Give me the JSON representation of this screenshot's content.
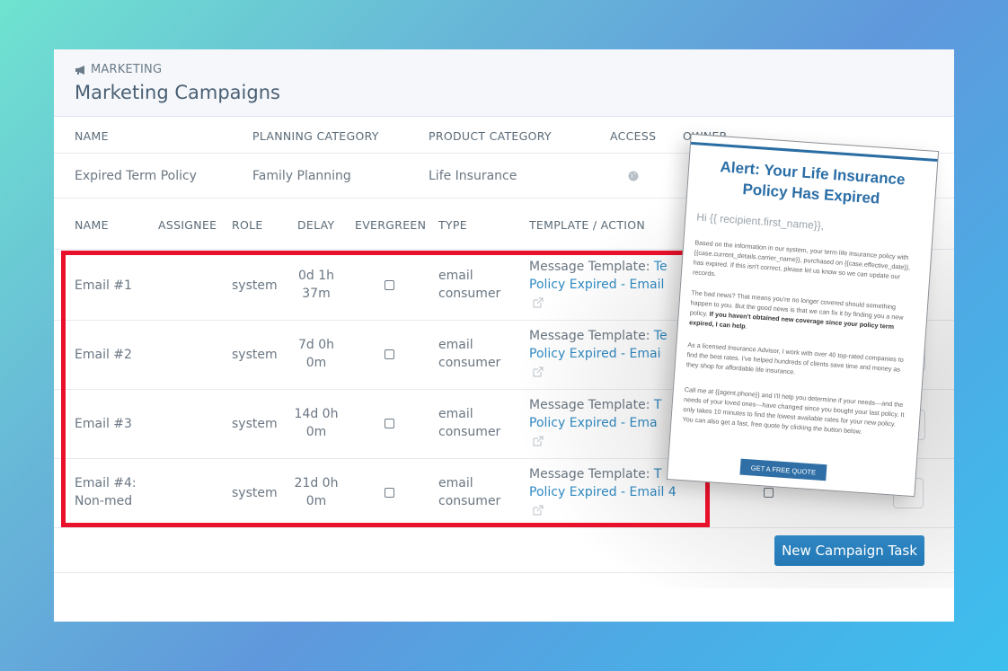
{
  "breadcrumb": {
    "icon": "megaphone-icon",
    "label": "MARKETING"
  },
  "page_title": "Marketing Campaigns",
  "campaign_table": {
    "headers": [
      "NAME",
      "PLANNING CATEGORY",
      "PRODUCT CATEGORY",
      "ACCESS",
      "OWNER"
    ],
    "row": {
      "name": "Expired Term Policy",
      "planning_category": "Family Planning",
      "product_category": "Life Insurance",
      "access_icon": "globe-icon"
    }
  },
  "tasks_table": {
    "headers": [
      "NAME",
      "ASSIGNEE",
      "ROLE",
      "DELAY",
      "EVERGREEN",
      "TYPE",
      "TEMPLATE / ACTION"
    ],
    "rows": [
      {
        "name": "Email #1",
        "assignee": "",
        "role": "system",
        "delay_line1": "0d 1h",
        "delay_line2": "37m",
        "evergreen": false,
        "type_line1": "email",
        "type_line2": "consumer",
        "template_prefix": "Message Template: ",
        "template_link_a": "Te",
        "template_link_b": "Policy Expired - Email"
      },
      {
        "name": "Email #2",
        "assignee": "",
        "role": "system",
        "delay_line1": "7d 0h",
        "delay_line2": "0m",
        "evergreen": false,
        "type_line1": "email",
        "type_line2": "consumer",
        "template_prefix": "Message Template: ",
        "template_link_a": "Te",
        "template_link_b": "Policy Expired - Emai"
      },
      {
        "name": "Email #3",
        "assignee": "",
        "role": "system",
        "delay_line1": "14d 0h",
        "delay_line2": "0m",
        "evergreen": false,
        "type_line1": "email",
        "type_line2": "consumer",
        "template_prefix": "Message Template: ",
        "template_link_a": "T",
        "template_link_b": "Policy Expired - Ema"
      },
      {
        "name": "Email #4:",
        "name_line2": "Non-med",
        "assignee": "",
        "role": "system",
        "delay_line1": "21d 0h",
        "delay_line2": "0m",
        "evergreen": false,
        "type_line1": "email",
        "type_line2": "consumer",
        "template_prefix": "Message Template: ",
        "template_link_a": "T",
        "template_link_b": "Policy Expired - Email 4"
      }
    ]
  },
  "new_task_button": "New Campaign Task",
  "highlight_color": "#e8102a",
  "accent_color": "#2f86c2",
  "email_preview": {
    "title": "Alert: Your Life Insurance Policy Has Expired",
    "greeting": "Hi {{ recipient.first_name}},",
    "p1": "Based on the information in our system, your term life insurance policy with {{case.current_details.carrier_name}}, purchased on {{case.effective_date}}, has expired. If this isn't correct, please let us know so we can update our records.",
    "p2_plain": "The bad news? That means you're no longer covered should something happen to you. But the good news is that we can fix it by finding you a new policy. ",
    "p2_bold": "If you haven't obtained new coverage since your policy term expired, I can help",
    "p2_end": ".",
    "p3": "As a licensed Insurance Advisor, I work with over 40 top-rated companies to find the best rates. I've helped hundreds of clients save time and money as they shop for affordable life insurance.",
    "p4": "Call me at {{agent.phone}} and I'll help you determine if your needs—and the needs of your loved ones—have changed since you bought your last policy. It only takes 10 minutes to find the lowest available rates for your new policy. You can also get a fast, free quote by clicking the button below.",
    "cta": "GET A FREE QUOTE"
  }
}
